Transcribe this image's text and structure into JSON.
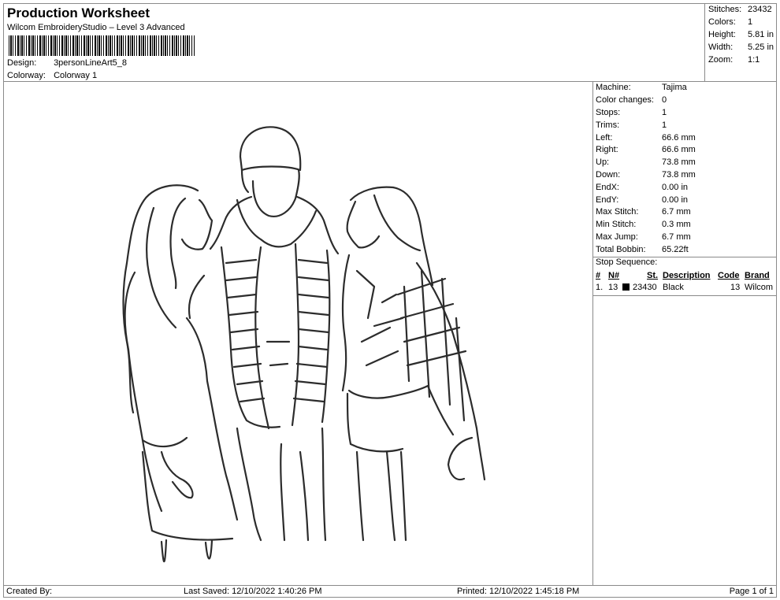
{
  "header": {
    "title": "Production Worksheet",
    "software": "Wilcom EmbroideryStudio – Level 3 Advanced",
    "design_label": "Design:",
    "design_value": "3personLineArt5_8",
    "colorway_label": "Colorway:",
    "colorway_value": "Colorway 1"
  },
  "summary": {
    "stitches_label": "Stitches:",
    "stitches_value": "23432",
    "colors_label": "Colors:",
    "colors_value": "1",
    "height_label": "Height:",
    "height_value": "5.81 in",
    "width_label": "Width:",
    "width_value": "5.25 in",
    "zoom_label": "Zoom:",
    "zoom_value": "1:1"
  },
  "machine": [
    {
      "label": "Machine:",
      "value": "Tajima"
    },
    {
      "label": "Color changes:",
      "value": "0"
    },
    {
      "label": "Stops:",
      "value": "1"
    },
    {
      "label": "Trims:",
      "value": "1"
    },
    {
      "label": "Left:",
      "value": "66.6 mm"
    },
    {
      "label": "Right:",
      "value": "66.6 mm"
    },
    {
      "label": "Up:",
      "value": "73.8 mm"
    },
    {
      "label": "Down:",
      "value": "73.8 mm"
    },
    {
      "label": "EndX:",
      "value": "0.00 in"
    },
    {
      "label": "EndY:",
      "value": "0.00 in"
    },
    {
      "label": "Max Stitch:",
      "value": "6.7 mm"
    },
    {
      "label": "Min Stitch:",
      "value": "0.3 mm"
    },
    {
      "label": "Max Jump:",
      "value": "6.7 mm"
    },
    {
      "label": "Total Bobbin:",
      "value": "65.22ft"
    }
  ],
  "stop_sequence": {
    "title": "Stop Sequence:",
    "headers": {
      "num": "#",
      "n": "N#",
      "st": "St.",
      "desc": "Description",
      "code": "Code",
      "brand": "Brand"
    },
    "rows": [
      {
        "num": "1.",
        "n": "13",
        "color": "#000000",
        "st": "23430",
        "desc": "Black",
        "code": "13",
        "brand": "Wilcom"
      }
    ]
  },
  "footer": {
    "created": "Created By:",
    "saved": "Last Saved: 12/10/2022 1:40:26 PM",
    "printed": "Printed: 12/10/2022 1:45:18 PM",
    "page": "Page 1 of 1"
  }
}
